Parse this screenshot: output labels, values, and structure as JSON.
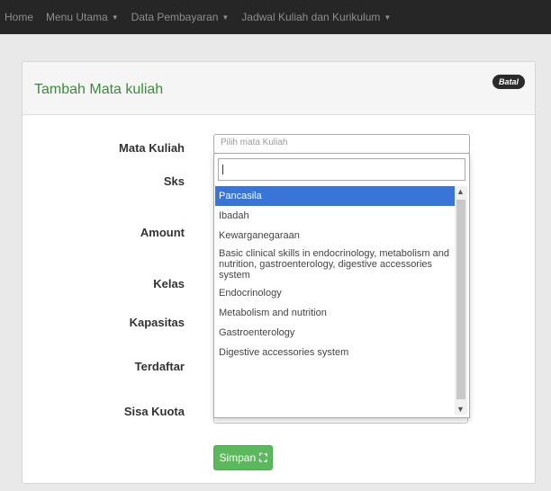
{
  "nav": {
    "items": [
      {
        "label": "Home",
        "dropdown": false
      },
      {
        "label": "Menu Utama",
        "dropdown": true
      },
      {
        "label": "Data Pembayaran",
        "dropdown": true
      },
      {
        "label": "Jadwal Kuliah dan Kurikulum",
        "dropdown": true
      }
    ]
  },
  "panel": {
    "title": "Tambah Mata kuliah",
    "cancel_label": "Batal"
  },
  "form": {
    "labels": {
      "mata_kuliah": "Mata Kuliah",
      "sks": "Sks",
      "amount": "Amount",
      "kelas": "Kelas",
      "kapasitas": "Kapasitas",
      "terdaftar": "Terdaftar",
      "sisa_kuota": "Sisa Kuota"
    },
    "select_placeholder": "Pilih mata Kuliah",
    "search_value": "",
    "options": [
      "Pancasila",
      "Ibadah",
      "Kewarganegaraan",
      "Basic clinical skills in endocrinology, metabolism and nutrition, gastroenterology, digestive accessories system",
      "Endocrinology",
      "Metabolism and nutrition",
      "Gastroenterology",
      "Digestive accessories system"
    ],
    "selected_option": "Pancasila",
    "save_label": "Simpan"
  },
  "icons": {
    "dropdown_caret": "caret-down-icon",
    "save": "save-icon",
    "scroll_up": "scroll-up-icon",
    "scroll_down": "scroll-down-icon"
  },
  "colors": {
    "navbar": "#262626",
    "title_green": "#3c8c3c",
    "highlight": "#3875d7",
    "save_button": "#5cb85c"
  }
}
